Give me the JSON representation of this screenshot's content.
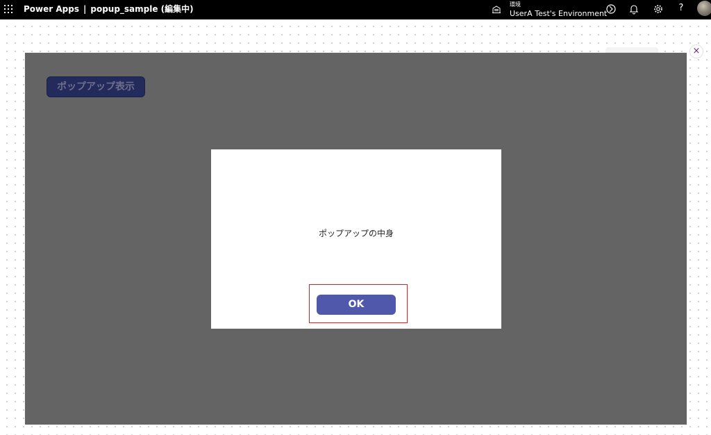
{
  "topbar": {
    "app_name": "Power Apps",
    "separator": "|",
    "document_title": "popup_sample (編集中)",
    "environment_label": "環境",
    "environment_name": "UserA Test's Environment",
    "help_label": "?",
    "icons": [
      "waffle-icon",
      "environment-icon",
      "copilot-icon",
      "bell-icon",
      "gear-icon",
      "help-icon",
      "avatar"
    ]
  },
  "canvas": {
    "close_label": "×",
    "device_toolbar": [
      "tablet-icon",
      "phone-icon",
      "desktop-icon"
    ]
  },
  "app_screen": {
    "show_popup_button_label": "ポップアップ表示",
    "popup": {
      "content_text": "ポップアップの中身",
      "ok_button_label": "OK"
    }
  },
  "colors": {
    "topbar_bg": "#000000",
    "screen_bg": "#646464",
    "popup_bg": "#ffffff",
    "button_primary": "#5058ab",
    "button_dimmed": "#232a5c",
    "highlight_border": "#e0201f",
    "accent": "#742774"
  }
}
